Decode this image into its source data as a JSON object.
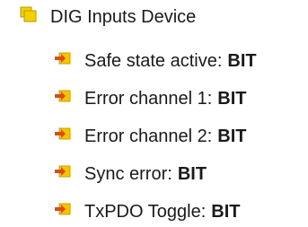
{
  "tree": {
    "root": {
      "label": "DIG Inputs Device",
      "icon": "folder-icon"
    },
    "children": [
      {
        "label": "Safe state active:",
        "type": "BIT",
        "icon": "input-variable-icon"
      },
      {
        "label": "Error channel 1:",
        "type": "BIT",
        "icon": "input-variable-icon"
      },
      {
        "label": "Error channel 2:",
        "type": "BIT",
        "icon": "input-variable-icon"
      },
      {
        "label": "Sync error:",
        "type": "BIT",
        "icon": "input-variable-icon"
      },
      {
        "label": "TxPDO Toggle:",
        "type": "BIT",
        "icon": "input-variable-icon"
      }
    ]
  },
  "colors": {
    "folder_fill": "#f5d000",
    "folder_border": "#b89a00",
    "icon_fill": "#f5c400",
    "arrow": "#e04a10"
  }
}
